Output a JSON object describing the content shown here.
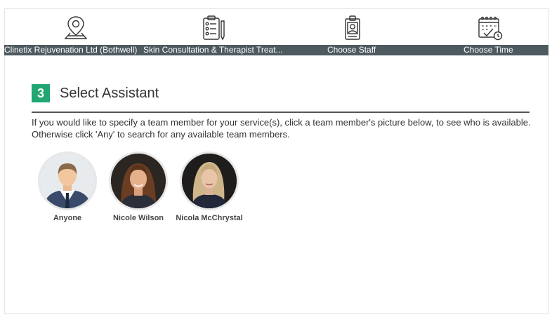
{
  "steps": [
    {
      "label": "Clinetix Rejuvenation Ltd (Bothwell)",
      "icon": "location-pin-icon"
    },
    {
      "label": "Skin Consultation & Therapist Treat...",
      "icon": "clipboard-list-icon"
    },
    {
      "label": "Choose Staff",
      "icon": "staff-badge-icon"
    },
    {
      "label": "Choose Time",
      "icon": "calendar-clock-icon"
    }
  ],
  "section": {
    "number": "3",
    "title": "Select Assistant",
    "instructions": "If you would like to specify a team member for your service(s), click a team member's picture below, to see who is available. Otherwise click 'Any' to search for any available team members."
  },
  "staff": [
    {
      "name": "Anyone"
    },
    {
      "name": "Nicole Wilson"
    },
    {
      "name": "Nicola McChrystal"
    }
  ],
  "colors": {
    "step_bar": "#4d5a60",
    "badge": "#22a672"
  }
}
